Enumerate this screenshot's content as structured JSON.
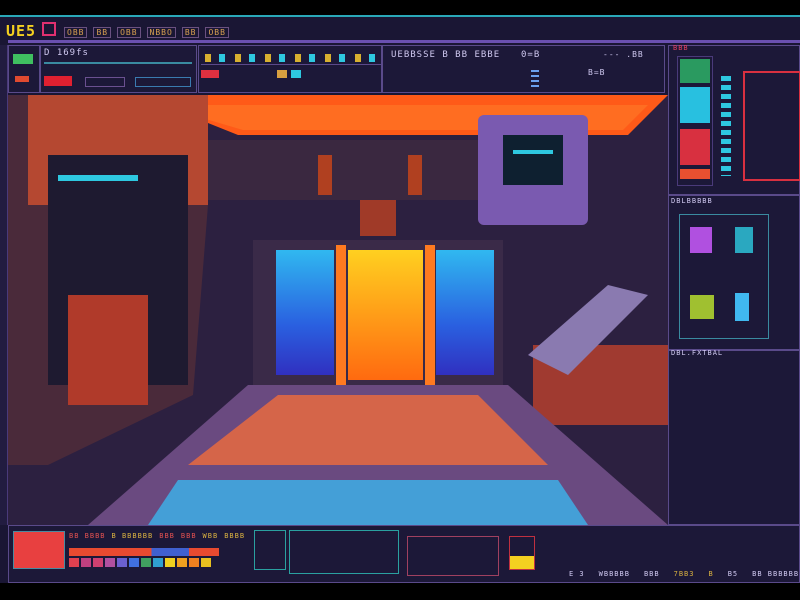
{
  "app": {
    "logo": "UE5",
    "colors": {
      "accent_cyan": "#2ec8e0",
      "accent_orange": "#ff6a1a",
      "accent_purple": "#7a4ad0",
      "panel": "#1c1838",
      "yellow": "#f4d020"
    }
  },
  "top_bar": {
    "menu_items": [
      "OBB",
      "BB",
      "OBB",
      "NBBO",
      "BB",
      "OBB"
    ]
  },
  "toolbar": {
    "fps_readout": "D 169fs",
    "status_label": "UEBBSSE B BB EBBE",
    "value_label": "0=B",
    "right_readout": "--- .ВВ",
    "mini_label": "B=B"
  },
  "right_panel": {
    "header": "ВВВ",
    "section_label": "DBLBBBBB",
    "footer_label": "DBL.FXTBAL"
  },
  "bottom_bar": {
    "palette_colors": [
      "#e04050",
      "#c04080",
      "#d04070",
      "#b050a0",
      "#6a60d0",
      "#4070e0",
      "#40a060",
      "#2fa0d0",
      "#f0d020",
      "#f0a020",
      "#f08020",
      "#e8c020"
    ],
    "labels": [
      "BB BBBB",
      "B BBBBBB",
      "BBB",
      "BBB",
      "WBB",
      "BBBB"
    ],
    "status": [
      "E 3",
      "WBBBBB",
      "BBB",
      "7BB3",
      "B",
      "B5",
      "BB BBBBBB"
    ]
  },
  "scene": {
    "type": "pixel-art sci-fi corridor",
    "door": "central orange door flanked by blue glass panels"
  }
}
